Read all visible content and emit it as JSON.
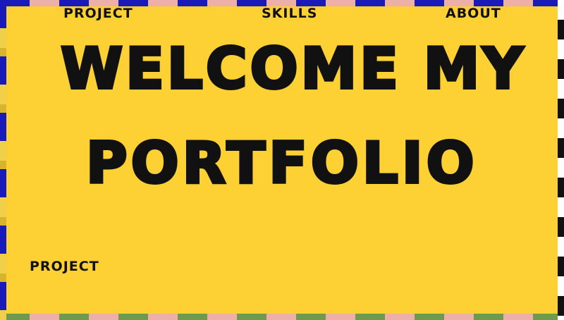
{
  "nav": {
    "items": [
      {
        "label": "PROJECT"
      },
      {
        "label": "SKILLS"
      },
      {
        "label": "ABOUT"
      }
    ]
  },
  "hero": {
    "line1": "WELCOME MY",
    "line2": "PORTFOLIO"
  },
  "section": {
    "label": "PROJECT"
  },
  "colors": {
    "background": "#fdd033",
    "text": "#111111",
    "stripe_blue": "#1a1ab8",
    "stripe_pink": "#ecb0a8",
    "stripe_green": "#6e9a4c"
  }
}
